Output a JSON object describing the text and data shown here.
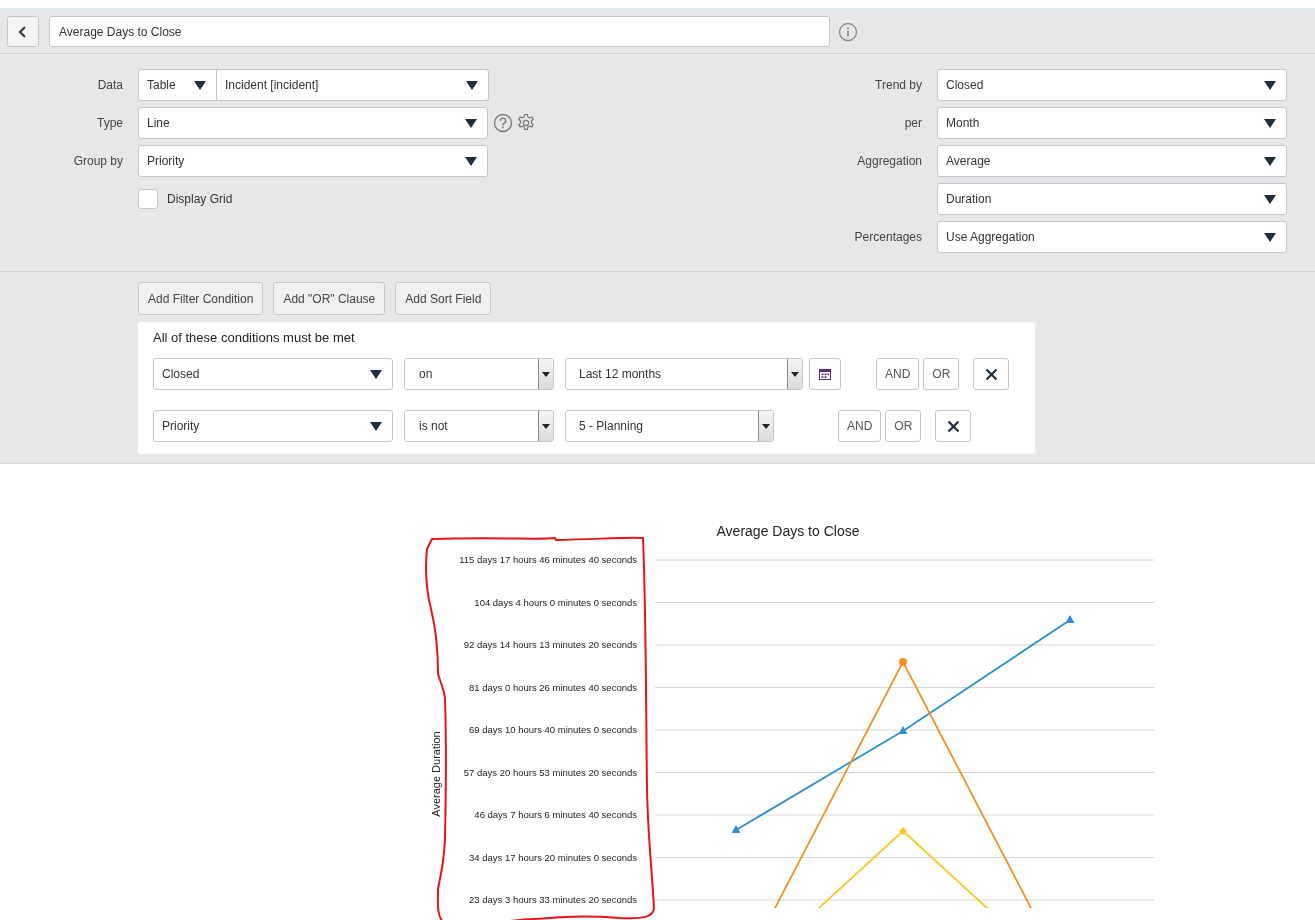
{
  "header": {
    "title": "Average Days to Close"
  },
  "form": {
    "left": [
      {
        "label": "Data",
        "kind": "split",
        "prefix": "Table",
        "value": "Incident [incident]"
      },
      {
        "label": "Type",
        "kind": "type",
        "value": "Line"
      },
      {
        "label": "Group by",
        "kind": "select",
        "value": "Priority"
      }
    ],
    "display_grid": {
      "label": "Display Grid",
      "checked": false
    },
    "right": [
      {
        "label": "Trend by",
        "value": "Closed"
      },
      {
        "label": "per",
        "value": "Month"
      },
      {
        "label": "Aggregation",
        "value": "Average"
      },
      {
        "value": "Duration"
      },
      {
        "label": "Percentages",
        "value": "Use Aggregation"
      }
    ]
  },
  "filter_buttons": [
    "Add Filter Condition",
    "Add \"OR\" Clause",
    "Add Sort Field"
  ],
  "conditions": {
    "heading": "All of these conditions must be met",
    "rows": [
      {
        "field": "Closed",
        "operator": "on",
        "value": "Last 12 months",
        "calendar": true,
        "and": "AND",
        "or": "OR"
      },
      {
        "field": "Priority",
        "operator": "is not",
        "value": "5 - Planning",
        "calendar": false,
        "and": "AND",
        "or": "OR"
      }
    ]
  },
  "chart": {
    "title": "Average Days to Close",
    "ylabel": "Average Duration",
    "y_axis_labels": [
      "115 days 17 hours 46 minutes 40 seconds",
      "104 days 4 hours 0 minutes 0 seconds",
      "92 days 14 hours 13 minutes 20 seconds",
      "81 days 0 hours 26 minutes 40 seconds",
      "69 days 10 hours 40 minutes 0 seconds",
      "57 days 20 hours 53 minutes 20 seconds",
      "46 days 7 hours 6 minutes 40 seconds",
      "34 days 17 hours 20 minutes 0 seconds",
      "23 days 3 hours 33 minutes 20 seconds"
    ]
  }
}
